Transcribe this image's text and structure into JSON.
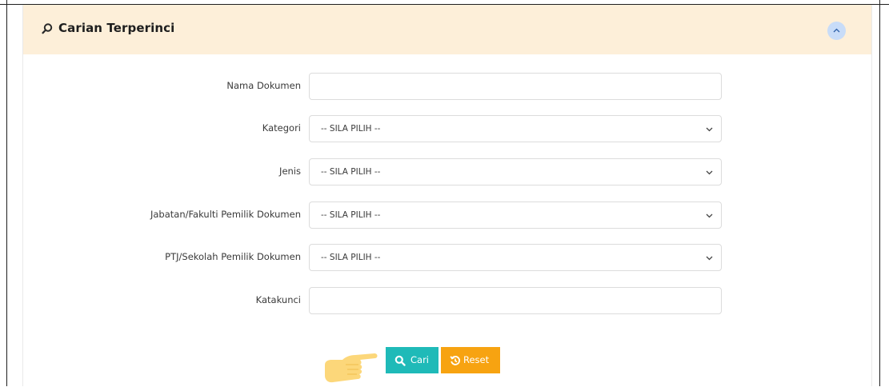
{
  "panel": {
    "title": "Carian Terperinci",
    "header_bg": "#fdefd9",
    "icons": {
      "title": "search-icon",
      "collapse": "chevron-up-icon"
    }
  },
  "form": {
    "fields": [
      {
        "label": "Nama Dokumen",
        "type": "text",
        "value": ""
      },
      {
        "label": "Kategori",
        "type": "select",
        "value": "-- SILA PILIH --"
      },
      {
        "label": "Jenis",
        "type": "select",
        "value": "-- SILA PILIH --"
      },
      {
        "label": "Jabatan/Fakulti Pemilik Dokumen",
        "type": "select",
        "value": "-- SILA PILIH --"
      },
      {
        "label": "PTJ/Sekolah Pemilik Dokumen",
        "type": "select",
        "value": "-- SILA PILIH --"
      },
      {
        "label": "Katakunci",
        "type": "text",
        "value": ""
      }
    ]
  },
  "actions": {
    "search_label": "Cari",
    "reset_label": "Reset",
    "search_color": "#1fbab8",
    "reset_color": "#f7a311",
    "icons": {
      "search": "search-icon",
      "reset": "history-icon",
      "pointer": "pointing-hand-icon"
    }
  }
}
